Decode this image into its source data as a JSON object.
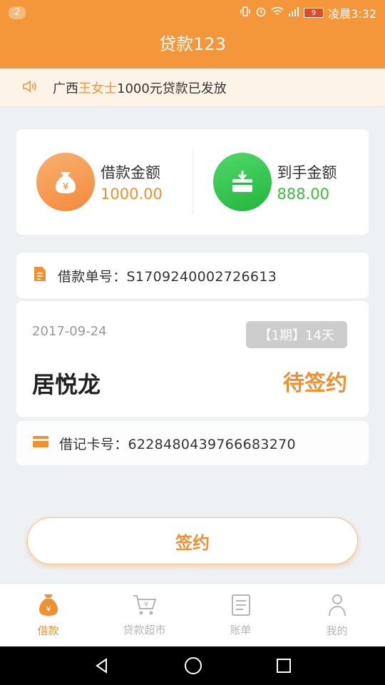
{
  "status_bar": {
    "notification_count": "2",
    "battery_level": "9",
    "time": "凌晨3:32"
  },
  "header": {
    "title": "贷款123"
  },
  "notice": {
    "prefix": "广西",
    "highlight": "王女士",
    "suffix": "1000元贷款已发放"
  },
  "amounts": {
    "loan": {
      "label": "借款金额",
      "value": "1000.00"
    },
    "received": {
      "label": "到手金额",
      "value": "888.00"
    }
  },
  "order": {
    "number_label": "借款单号：",
    "number": "S1709240002726613",
    "date": "2017-09-24",
    "period_tag": "【1期】14天",
    "borrower": "居悦龙",
    "status": "待签约",
    "card_label": "借记卡号：",
    "card_number": "6228480439766683270"
  },
  "sign_button": {
    "label": "签约"
  },
  "tabs": [
    {
      "label": "借款",
      "icon": "money-bag-icon",
      "active": true
    },
    {
      "label": "贷款超市",
      "icon": "cart-icon",
      "active": false
    },
    {
      "label": "账单",
      "icon": "bill-icon",
      "active": false
    },
    {
      "label": "我的",
      "icon": "user-icon",
      "active": false
    }
  ],
  "colors": {
    "brand": "#f4963a",
    "accent_orange": "#f0902e",
    "accent_green": "#3bbf3b",
    "tag_gray": "#cccccc"
  }
}
